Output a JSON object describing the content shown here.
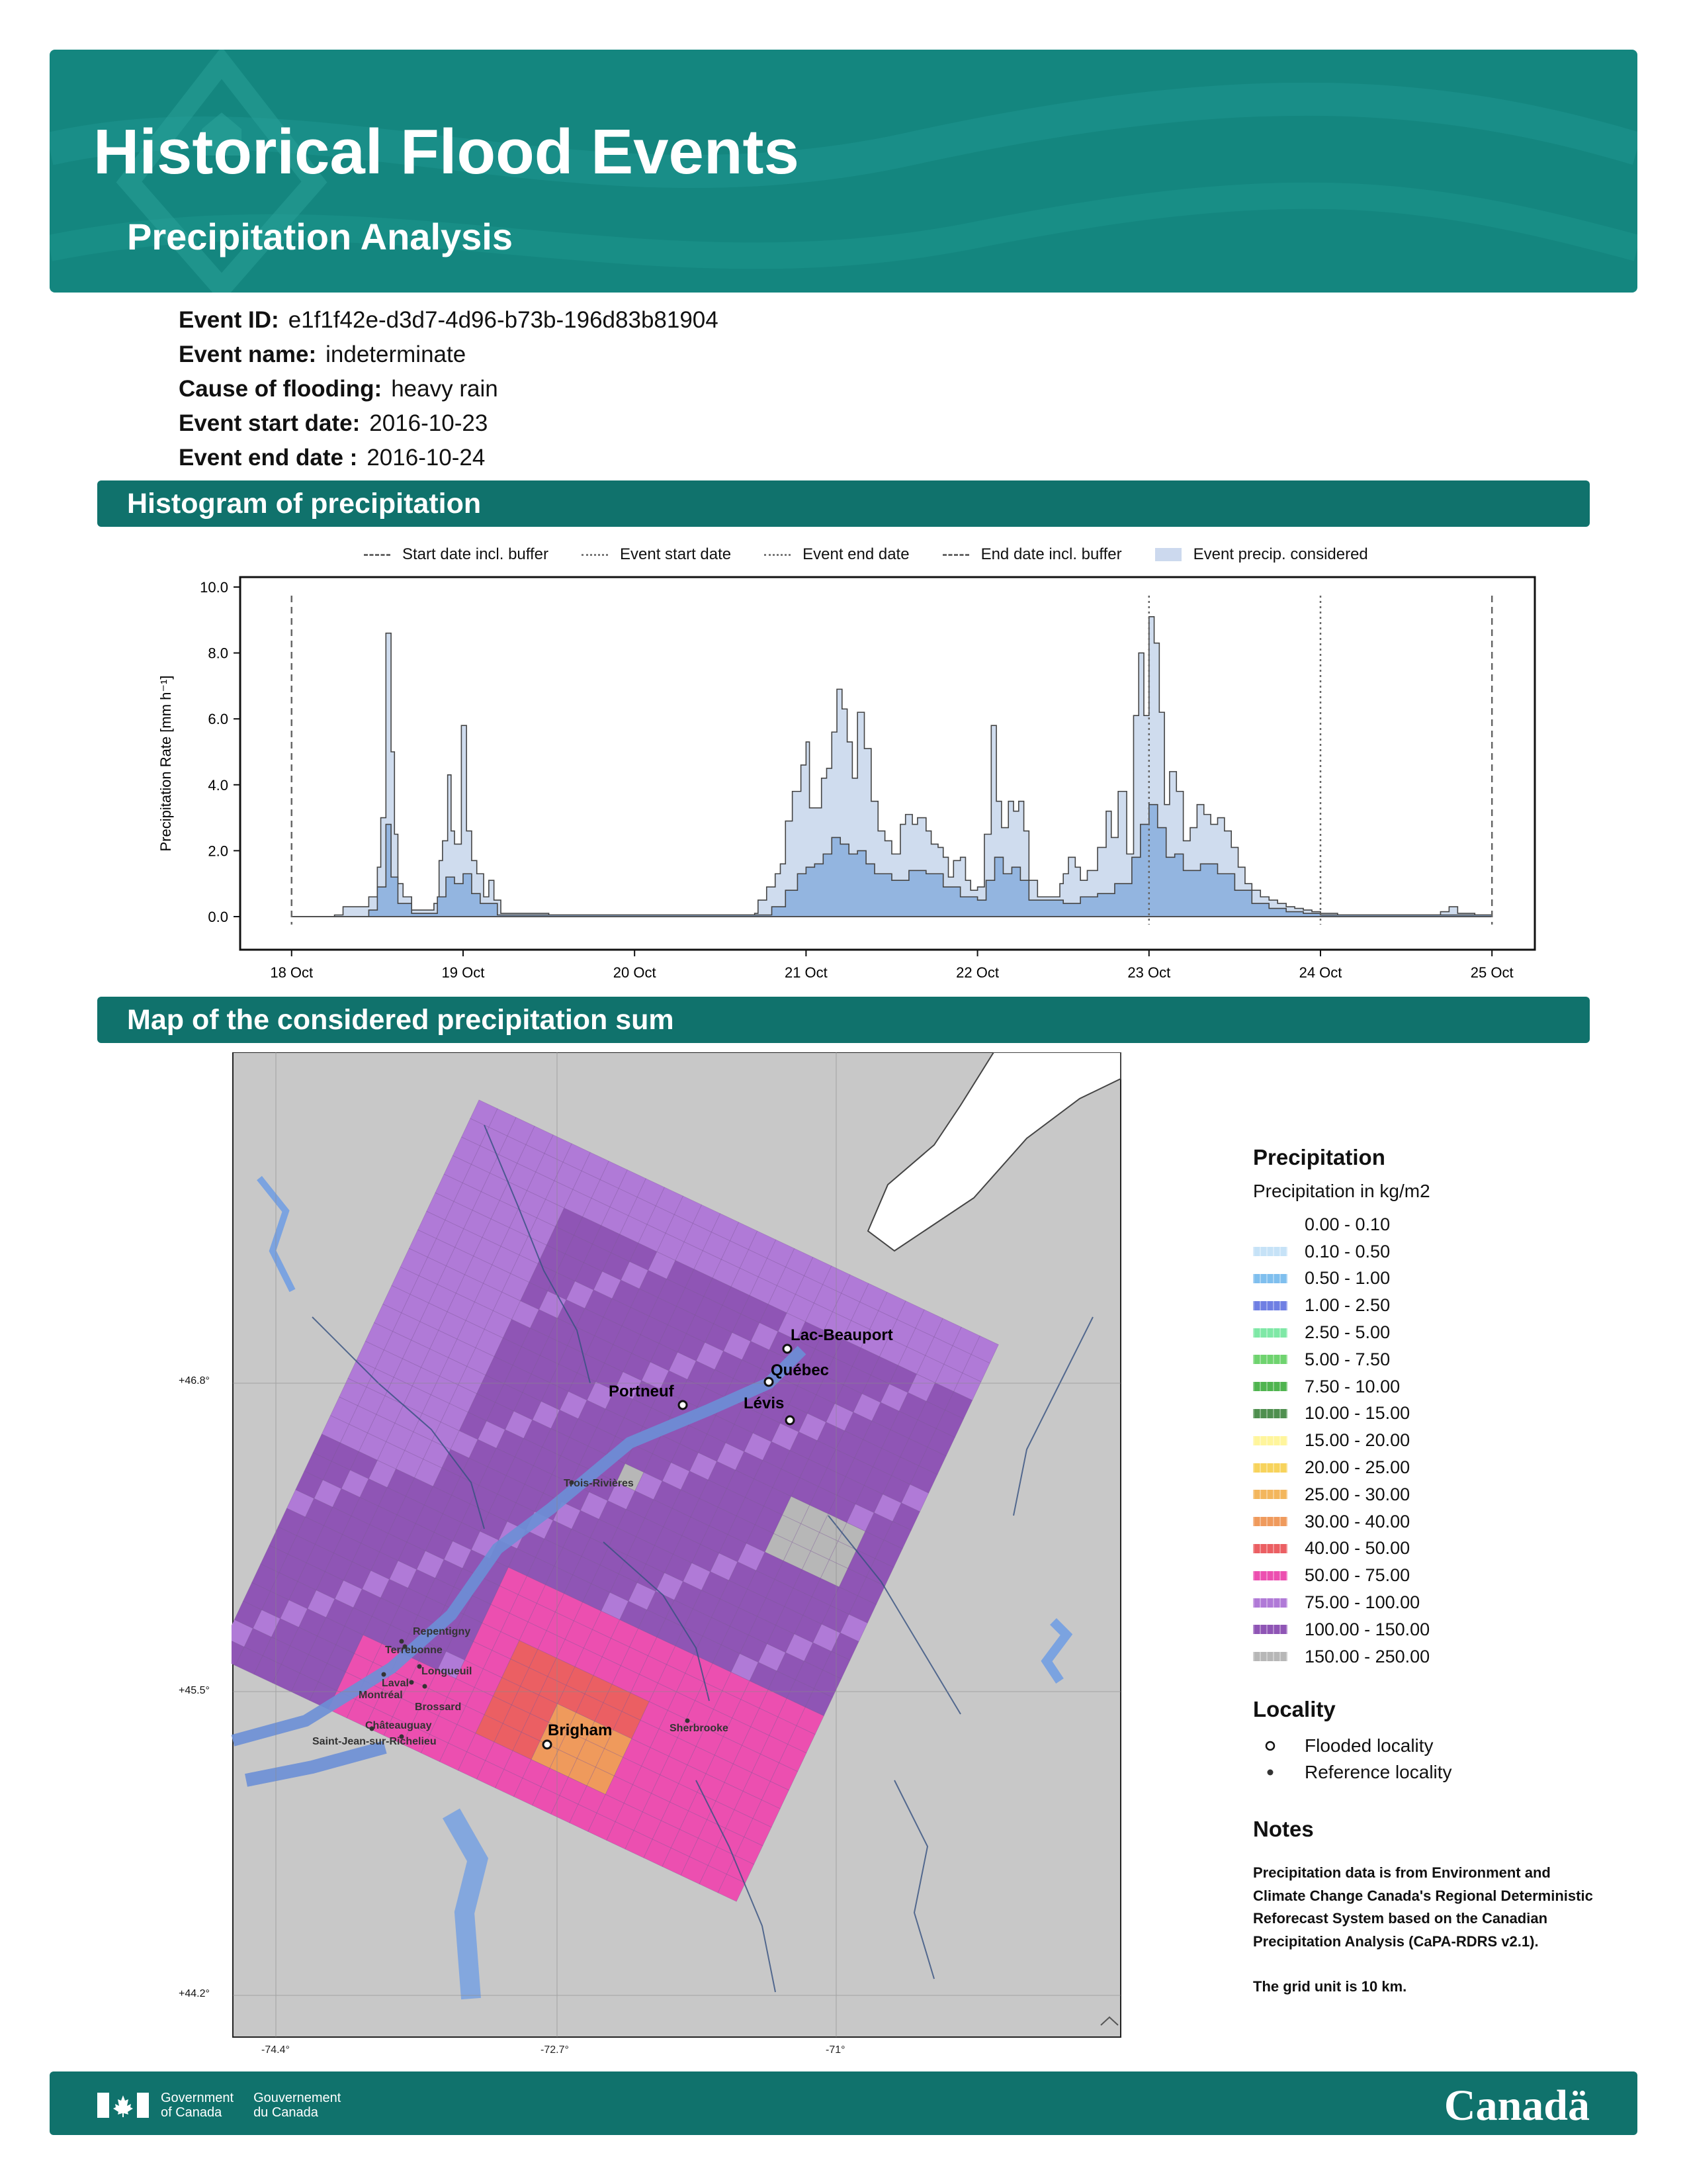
{
  "header": {
    "title": "Historical Flood Events",
    "subtitle": "Precipitation Analysis"
  },
  "event": {
    "fields": [
      {
        "label": "Event ID:",
        "value": "e1f1f42e-d3d7-4d96-b73b-196d83b81904"
      },
      {
        "label": "Event name:",
        "value": "indeterminate"
      },
      {
        "label": "Cause of flooding:",
        "value": "heavy rain"
      },
      {
        "label": "Event start date:",
        "value": "2016-10-23"
      },
      {
        "label": "Event end date :",
        "value": "2016-10-24"
      }
    ]
  },
  "sections": {
    "histogram": "Histogram of precipitation",
    "map": "Map of the considered precipitation sum"
  },
  "histogram_legend": [
    {
      "label": "Start date incl. buffer",
      "style": "dashed"
    },
    {
      "label": "Event start date",
      "style": "dotted"
    },
    {
      "label": "Event end date",
      "style": "dotted"
    },
    {
      "label": "End date incl. buffer",
      "style": "dashdot"
    },
    {
      "label": "Event precip. considered",
      "style": "fill"
    }
  ],
  "chart_data": {
    "type": "bar",
    "title": "",
    "xlabel": "",
    "ylabel": "Precipitation Rate [mm h⁻¹]",
    "ylim": [
      0,
      10
    ],
    "yticks": [
      "0.0",
      "2.0",
      "4.0",
      "6.0",
      "8.0",
      "10.0"
    ],
    "xticks": [
      "18 Oct",
      "19 Oct",
      "20 Oct",
      "21 Oct",
      "22 Oct",
      "23 Oct",
      "24 Oct",
      "25 Oct"
    ],
    "xlim_days": [
      17.7,
      25.25
    ],
    "vertical_lines": [
      {
        "day": 18.0,
        "style": "dashed"
      },
      {
        "day": 23.0,
        "style": "dotted"
      },
      {
        "day": 24.0,
        "style": "dotted"
      },
      {
        "day": 25.0,
        "style": "dashed"
      }
    ],
    "x_unit": "day of October 2016",
    "y_unit": "mm h-1",
    "series": [
      {
        "name": "Event precip. considered",
        "role": "max",
        "points": [
          [
            18.0,
            0
          ],
          [
            18.25,
            0.05
          ],
          [
            18.3,
            0.3
          ],
          [
            18.4,
            0.3
          ],
          [
            18.45,
            0.6
          ],
          [
            18.5,
            1.5
          ],
          [
            18.52,
            3
          ],
          [
            18.55,
            8.6
          ],
          [
            18.58,
            5
          ],
          [
            18.6,
            2.5
          ],
          [
            18.62,
            1
          ],
          [
            18.65,
            0.6
          ],
          [
            18.7,
            0.2
          ],
          [
            18.8,
            0.2
          ],
          [
            18.83,
            0.4
          ],
          [
            18.86,
            1.7
          ],
          [
            18.88,
            2.3
          ],
          [
            18.91,
            4.3
          ],
          [
            18.93,
            2.6
          ],
          [
            18.95,
            2.2
          ],
          [
            18.99,
            5.8
          ],
          [
            19.02,
            2.6
          ],
          [
            19.05,
            1.7
          ],
          [
            19.08,
            1.3
          ],
          [
            19.12,
            0.6
          ],
          [
            19.15,
            1.1
          ],
          [
            19.18,
            0.5
          ],
          [
            19.22,
            0.1
          ],
          [
            19.5,
            0.05
          ],
          [
            20.5,
            0.05
          ],
          [
            20.7,
            0.1
          ],
          [
            20.72,
            0.5
          ],
          [
            20.77,
            0.9
          ],
          [
            20.82,
            1.3
          ],
          [
            20.85,
            1.6
          ],
          [
            20.88,
            2.9
          ],
          [
            20.92,
            3.8
          ],
          [
            20.97,
            4.6
          ],
          [
            21.0,
            5.3
          ],
          [
            21.02,
            3.3
          ],
          [
            21.05,
            3.3
          ],
          [
            21.09,
            4.2
          ],
          [
            21.12,
            4.5
          ],
          [
            21.15,
            5.6
          ],
          [
            21.18,
            6.9
          ],
          [
            21.21,
            6.3
          ],
          [
            21.24,
            5.3
          ],
          [
            21.27,
            4.2
          ],
          [
            21.3,
            6.2
          ],
          [
            21.34,
            5.1
          ],
          [
            21.38,
            3.5
          ],
          [
            21.42,
            2.6
          ],
          [
            21.46,
            2.3
          ],
          [
            21.5,
            1.9
          ],
          [
            21.55,
            2.8
          ],
          [
            21.58,
            3.1
          ],
          [
            21.62,
            2.8
          ],
          [
            21.65,
            3.0
          ],
          [
            21.7,
            2.6
          ],
          [
            21.73,
            2.2
          ],
          [
            21.77,
            2.1
          ],
          [
            21.8,
            1.8
          ],
          [
            21.83,
            1.2
          ],
          [
            21.86,
            1.7
          ],
          [
            21.9,
            1.8
          ],
          [
            21.93,
            1.1
          ],
          [
            21.96,
            0.8
          ],
          [
            22.0,
            0.9
          ],
          [
            22.04,
            2.5
          ],
          [
            22.08,
            5.8
          ],
          [
            22.11,
            3.5
          ],
          [
            22.14,
            2.7
          ],
          [
            22.18,
            3.5
          ],
          [
            22.21,
            3.2
          ],
          [
            22.24,
            3.5
          ],
          [
            22.27,
            2.6
          ],
          [
            22.3,
            1.1
          ],
          [
            22.35,
            0.6
          ],
          [
            22.48,
            1.0
          ],
          [
            22.5,
            1.3
          ],
          [
            22.53,
            1.8
          ],
          [
            22.57,
            1.5
          ],
          [
            22.6,
            1.1
          ],
          [
            22.64,
            1.4
          ],
          [
            22.7,
            2.1
          ],
          [
            22.75,
            3.2
          ],
          [
            22.78,
            2.4
          ],
          [
            22.82,
            3.8
          ],
          [
            22.87,
            1.9
          ],
          [
            22.91,
            6.1
          ],
          [
            22.94,
            8.0
          ],
          [
            22.97,
            6.1
          ],
          [
            23.0,
            9.1
          ],
          [
            23.03,
            8.3
          ],
          [
            23.06,
            6.2
          ],
          [
            23.09,
            3.4
          ],
          [
            23.12,
            4.4
          ],
          [
            23.16,
            3.8
          ],
          [
            23.2,
            2.3
          ],
          [
            23.24,
            2.7
          ],
          [
            23.28,
            3.4
          ],
          [
            23.32,
            3.1
          ],
          [
            23.36,
            2.8
          ],
          [
            23.4,
            3.0
          ],
          [
            23.44,
            2.6
          ],
          [
            23.48,
            2.1
          ],
          [
            23.52,
            1.5
          ],
          [
            23.56,
            1.0
          ],
          [
            23.6,
            0.8
          ],
          [
            23.65,
            0.6
          ],
          [
            23.7,
            0.5
          ],
          [
            23.75,
            0.4
          ],
          [
            23.8,
            0.3
          ],
          [
            23.85,
            0.25
          ],
          [
            23.9,
            0.2
          ],
          [
            23.95,
            0.15
          ],
          [
            24.0,
            0.1
          ],
          [
            24.1,
            0.05
          ],
          [
            24.5,
            0.05
          ],
          [
            24.7,
            0.15
          ],
          [
            24.75,
            0.3
          ],
          [
            24.8,
            0.1
          ],
          [
            24.9,
            0.05
          ],
          [
            25.0,
            0.0
          ]
        ]
      },
      {
        "name": "Event precip. considered",
        "role": "mean",
        "points": [
          [
            18.0,
            0
          ],
          [
            18.45,
            0.2
          ],
          [
            18.5,
            0.9
          ],
          [
            18.55,
            2.8
          ],
          [
            18.58,
            1.2
          ],
          [
            18.62,
            0.4
          ],
          [
            18.7,
            0.1
          ],
          [
            18.85,
            0.6
          ],
          [
            18.9,
            1.2
          ],
          [
            18.95,
            1.0
          ],
          [
            19.0,
            1.3
          ],
          [
            19.05,
            0.7
          ],
          [
            19.1,
            0.4
          ],
          [
            19.2,
            0.05
          ],
          [
            20.7,
            0.05
          ],
          [
            20.8,
            0.3
          ],
          [
            20.88,
            0.8
          ],
          [
            20.95,
            1.3
          ],
          [
            21.0,
            1.5
          ],
          [
            21.05,
            1.6
          ],
          [
            21.1,
            1.9
          ],
          [
            21.15,
            2.4
          ],
          [
            21.2,
            2.2
          ],
          [
            21.25,
            1.9
          ],
          [
            21.3,
            2.0
          ],
          [
            21.35,
            1.6
          ],
          [
            21.4,
            1.3
          ],
          [
            21.5,
            1.1
          ],
          [
            21.6,
            1.4
          ],
          [
            21.7,
            1.3
          ],
          [
            21.8,
            0.9
          ],
          [
            21.9,
            0.6
          ],
          [
            22.0,
            0.5
          ],
          [
            22.05,
            1.1
          ],
          [
            22.1,
            1.8
          ],
          [
            22.15,
            1.3
          ],
          [
            22.2,
            1.5
          ],
          [
            22.25,
            1.1
          ],
          [
            22.3,
            0.5
          ],
          [
            22.5,
            0.4
          ],
          [
            22.6,
            0.6
          ],
          [
            22.7,
            0.7
          ],
          [
            22.8,
            1.0
          ],
          [
            22.9,
            1.8
          ],
          [
            22.95,
            2.8
          ],
          [
            23.0,
            3.4
          ],
          [
            23.05,
            2.7
          ],
          [
            23.1,
            1.8
          ],
          [
            23.15,
            1.9
          ],
          [
            23.2,
            1.4
          ],
          [
            23.3,
            1.6
          ],
          [
            23.4,
            1.3
          ],
          [
            23.5,
            0.8
          ],
          [
            23.6,
            0.4
          ],
          [
            23.7,
            0.25
          ],
          [
            23.8,
            0.15
          ],
          [
            23.9,
            0.1
          ],
          [
            24.0,
            0.05
          ],
          [
            25.0,
            0.0
          ]
        ]
      }
    ]
  },
  "map": {
    "lon_labels": [
      "-74.4°",
      "-72.7°",
      "-71°"
    ],
    "lat_labels": [
      "+46.8°",
      "+45.5°",
      "+44.2°"
    ],
    "flooded_localities": [
      "Lac-Beauport",
      "Québec",
      "Portneuf",
      "Lévis",
      "Brigham"
    ],
    "reference_localities": [
      "Trois-Rivières",
      "Repentigny",
      "Terrebonne",
      "Longueuil",
      "Laval",
      "Montréal",
      "Brossard",
      "Châteauguay",
      "Saint-Jean-sur-Richelieu",
      "Sherbrooke"
    ]
  },
  "legend": {
    "precip_title": "Precipitation",
    "precip_subtitle": "Precipitation in kg/m2",
    "bins": [
      {
        "label": "0.00 - 0.10",
        "color": "#ffffff"
      },
      {
        "label": "0.10 - 0.50",
        "color": "#c6e2f7"
      },
      {
        "label": "0.50 - 1.00",
        "color": "#7fbfee"
      },
      {
        "label": "1.00 - 2.50",
        "color": "#6f7fe3"
      },
      {
        "label": "2.50 - 5.00",
        "color": "#7fe8a6"
      },
      {
        "label": "5.00 - 7.50",
        "color": "#6fd36f"
      },
      {
        "label": "7.50 - 10.00",
        "color": "#4fb44f"
      },
      {
        "label": "10.00 - 15.00",
        "color": "#4f8f4f"
      },
      {
        "label": "15.00 - 20.00",
        "color": "#fff59c"
      },
      {
        "label": "20.00 - 25.00",
        "color": "#f7d35c"
      },
      {
        "label": "25.00 - 30.00",
        "color": "#f3b65c"
      },
      {
        "label": "30.00 - 40.00",
        "color": "#ef9a5c"
      },
      {
        "label": "40.00 - 50.00",
        "color": "#eb5f63"
      },
      {
        "label": "50.00 - 75.00",
        "color": "#ec4fb0"
      },
      {
        "label": "75.00 - 100.00",
        "color": "#b07ad7"
      },
      {
        "label": "100.00 - 150.00",
        "color": "#8f55b5"
      },
      {
        "label": "150.00 - 250.00",
        "color": "#b7b7b7"
      }
    ],
    "locality_title": "Locality",
    "locality_items": [
      "Flooded locality",
      "Reference locality"
    ]
  },
  "notes": {
    "title": "Notes",
    "text": "Precipitation data is from Environment and Climate Change Canada's Regional Deterministic Reforecast System based on the Canadian Precipitation Analysis (CaPA-RDRS v2.1).",
    "grid": "The grid unit is 10 km."
  },
  "footer": {
    "gov_en_1": "Government",
    "gov_en_2": "of Canada",
    "gov_fr_1": "Gouvernement",
    "gov_fr_2": "du Canada",
    "wordmark": "Canadä"
  }
}
